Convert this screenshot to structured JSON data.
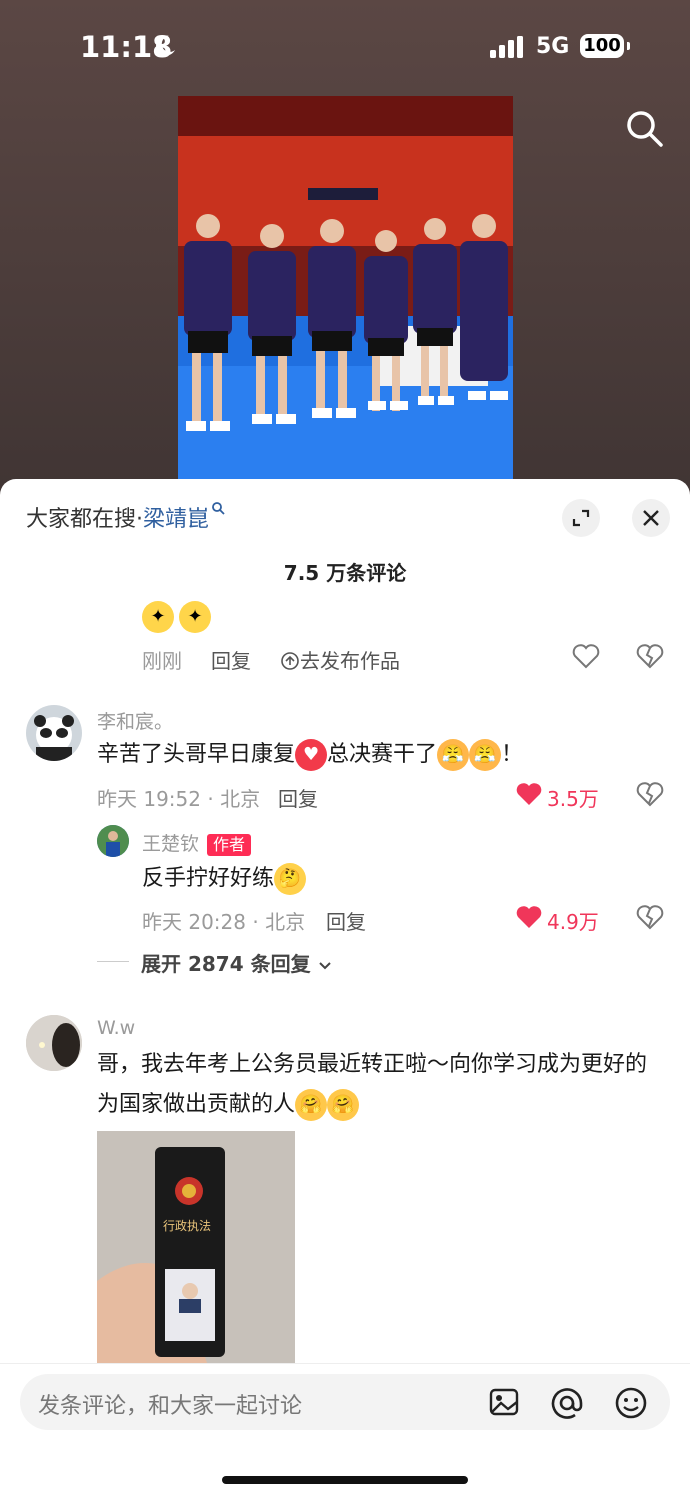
{
  "status": {
    "time": "11:18",
    "network": "5G",
    "battery": "100"
  },
  "header": {
    "hot_prefix": "大家都在搜·",
    "hot_keyword": "梁靖崑"
  },
  "comments_title": "7.5 万条评论",
  "prev_comment": {
    "time": "刚刚",
    "reply": "回复",
    "publish": "去发布作品"
  },
  "comments": [
    {
      "name": "李和宸。",
      "text": "辛苦了头哥早日康复",
      "text2": "总决赛干了",
      "text3": "！",
      "time": "昨天 19:52 · 北京",
      "reply": "回复",
      "likes": "3.5万"
    },
    {
      "name": "王楚钦",
      "tag": "作者",
      "text": "反手拧好好练",
      "time": "昨天 20:28 · 北京",
      "reply": "回复",
      "likes": "4.9万"
    },
    {
      "expand": "展开 2874 条回复"
    },
    {
      "name": "W.w",
      "text": "哥，我去年考上公务员最近转正啦～向你学习成为更好的为国家做出贡献的人",
      "badge_text": "行政执法"
    }
  ],
  "input": {
    "placeholder": "发条评论，和大家一起讨论"
  },
  "colors": {
    "accent": "#fe2c55",
    "link": "#2f5f9f"
  }
}
